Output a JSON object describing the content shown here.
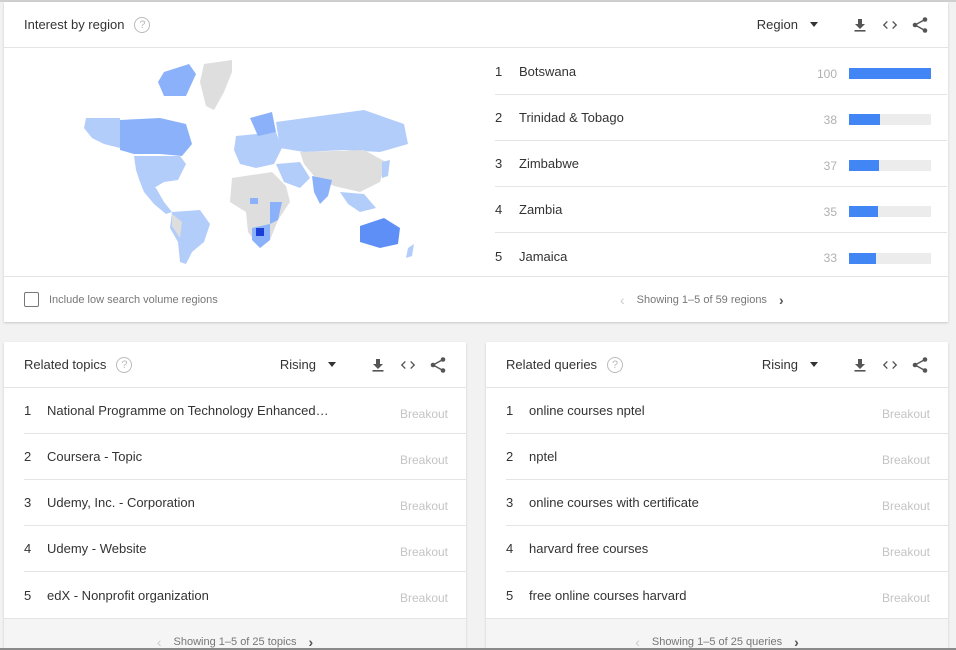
{
  "interest_by_region": {
    "title": "Interest by region",
    "help_icon": "?",
    "resolution_select": "Region",
    "tools": [
      "download-icon",
      "embed-icon",
      "share-icon"
    ],
    "regions": [
      {
        "rank": "1",
        "name": "Botswana",
        "value": "100",
        "fraction": 1.0
      },
      {
        "rank": "2",
        "name": "Trinidad & Tobago",
        "value": "38",
        "fraction": 0.38
      },
      {
        "rank": "3",
        "name": "Zimbabwe",
        "value": "37",
        "fraction": 0.37
      },
      {
        "rank": "4",
        "name": "Zambia",
        "value": "35",
        "fraction": 0.35
      },
      {
        "rank": "5",
        "name": "Jamaica",
        "value": "33",
        "fraction": 0.33
      }
    ],
    "low_volume_checkbox": {
      "label": "Include low search volume regions",
      "checked": false
    },
    "pager": {
      "prev": "‹",
      "text": "Showing 1–5 of 59 regions",
      "next": "›"
    },
    "map": {
      "colors": {
        "no_data": "#dedede",
        "low": "#b3cdfb",
        "mid": "#8ab1f9",
        "high": "#5e8ff6",
        "max": "#1a3fd6"
      }
    }
  },
  "related_topics": {
    "title": "Related topics",
    "help_icon": "?",
    "select": "Rising",
    "items": [
      {
        "rank": "1",
        "label": "National Programme on Technology Enhanced…",
        "value": "Breakout"
      },
      {
        "rank": "2",
        "label": "Coursera - Topic",
        "value": "Breakout"
      },
      {
        "rank": "3",
        "label": "Udemy, Inc. - Corporation",
        "value": "Breakout"
      },
      {
        "rank": "4",
        "label": "Udemy - Website",
        "value": "Breakout"
      },
      {
        "rank": "5",
        "label": "edX - Nonprofit organization",
        "value": "Breakout"
      }
    ],
    "pager": {
      "prev": "‹",
      "text": "Showing 1–5 of 25 topics",
      "next": "›"
    }
  },
  "related_queries": {
    "title": "Related queries",
    "help_icon": "?",
    "select": "Rising",
    "items": [
      {
        "rank": "1",
        "label": "online courses nptel",
        "value": "Breakout"
      },
      {
        "rank": "2",
        "label": "nptel",
        "value": "Breakout"
      },
      {
        "rank": "3",
        "label": "online courses with certificate",
        "value": "Breakout"
      },
      {
        "rank": "4",
        "label": "harvard free courses",
        "value": "Breakout"
      },
      {
        "rank": "5",
        "label": "free online courses harvard",
        "value": "Breakout"
      }
    ],
    "pager": {
      "prev": "‹",
      "text": "Showing 1–5 of 25 queries",
      "next": "›"
    }
  },
  "accent_color": "#4285f4"
}
